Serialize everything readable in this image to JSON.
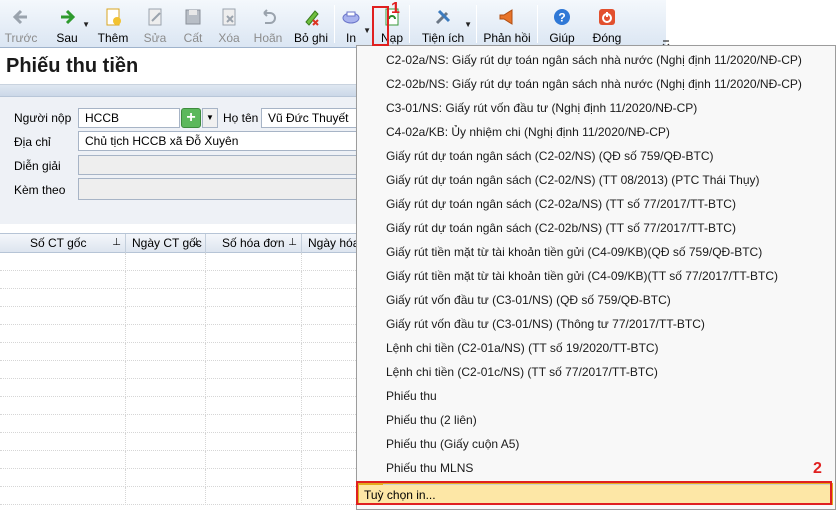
{
  "toolbar": {
    "buttons": {
      "back": "Trước",
      "next": "Sau",
      "add": "Thêm",
      "edit": "Sửa",
      "save": "Cất",
      "delete": "Xóa",
      "undo": "Hoãn",
      "unpost": "Bỏ ghi",
      "print": "In",
      "load": "Nạp",
      "utilities": "Tiện ích",
      "feedback": "Phản hồi",
      "help": "Giúp",
      "close": "Đóng"
    }
  },
  "page": {
    "title": "Phiếu thu tiền"
  },
  "form": {
    "payer_label": "Người nộp",
    "payer_value": "HCCB",
    "name_label": "Họ tên",
    "name_value": "Vũ Đức Thuyết",
    "address_label": "Địa chỉ",
    "address_value": "Chủ tịch HCCB xã Đỗ Xuyên",
    "description_label": "Diễn giải",
    "description_value": "",
    "attach_label": "Kèm theo",
    "attach_value": ""
  },
  "grid": {
    "columns": [
      "Số CT gốc",
      "Ngày CT gốc",
      "Số hóa đơn",
      "Ngày hóa"
    ]
  },
  "menu": {
    "items": [
      "C2-02a/NS: Giấy rút dự toán ngân sách nhà nước (Nghị định 11/2020/NĐ-CP)",
      "C2-02b/NS: Giấy rút dự toán ngân sách nhà nước (Nghị định 11/2020/NĐ-CP)",
      "C3-01/NS: Giấy rút vốn đầu tư (Nghị định 11/2020/NĐ-CP)",
      "C4-02a/KB: Ủy nhiệm chi (Nghị định 11/2020/NĐ-CP)",
      "Giấy rút dự toán ngân sách (C2-02/NS) (QĐ số 759/QĐ-BTC)",
      "Giấy rút dự toán ngân sách (C2-02/NS) (TT 08/2013) (PTC Thái Thụy)",
      "Giấy rút dự toán ngân sách (C2-02a/NS) (TT số 77/2017/TT-BTC)",
      "Giấy rút dự toán ngân sách (C2-02b/NS) (TT số 77/2017/TT-BTC)",
      "Giấy rút tiền mặt từ tài khoản tiền gửi (C4-09/KB)(QĐ số 759/QĐ-BTC)",
      "Giấy rút tiền mặt từ tài khoản tiền gửi (C4-09/KB)(TT số 77/2017/TT-BTC)",
      "Giấy rút vốn đầu tư (C3-01/NS) (QĐ số 759/QĐ-BTC)",
      "Giấy rút vốn đầu tư (C3-01/NS) (Thông tư 77/2017/TT-BTC)",
      "Lệnh chi tiền (C2-01a/NS) (TT số 19/2020/TT-BTC)",
      "Lệnh chi tiền (C2-01c/NS) (TT số 77/2017/TT-BTC)",
      "Phiếu thu",
      "Phiếu thu (2 liên)",
      "Phiếu thu (Giấy cuộn A5)",
      "Phiếu thu MLNS"
    ],
    "print_options": "Tuỳ chọn in..."
  },
  "annotations": {
    "step1": "1",
    "step2": "2"
  },
  "colors": {
    "highlight": "#fde7a6",
    "annotation": "#e02020"
  }
}
